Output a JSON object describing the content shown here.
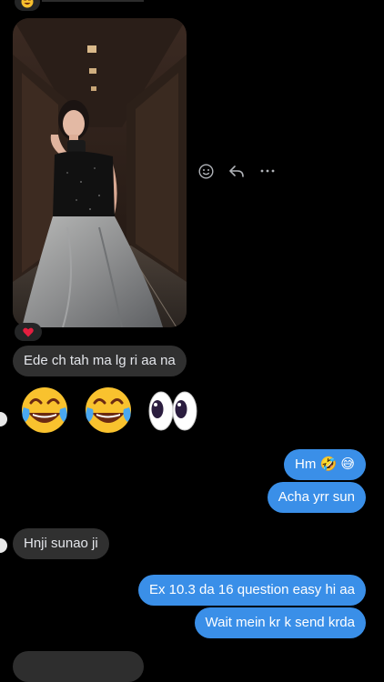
{
  "messages": {
    "incoming_1": "Ede ch tah ma lg ri aa na",
    "incoming_2": "Hnji sunao ji",
    "outgoing_1": "Hm 🤣 😅",
    "outgoing_2": "Acha yrr sun",
    "outgoing_3": "Ex 10.3 da 16 question easy hi aa",
    "outgoing_4": "Wait mein kr k send krda"
  },
  "reactions": {
    "photo_reaction": "heart",
    "top_reaction": "laughing"
  },
  "big_emojis": [
    "tears-of-joy",
    "tears-of-joy",
    "eyes"
  ],
  "colors": {
    "background": "#000000",
    "incoming_bubble": "#303030",
    "outgoing_bubble": "#3a8fe8",
    "heart": "#e41e3f"
  }
}
